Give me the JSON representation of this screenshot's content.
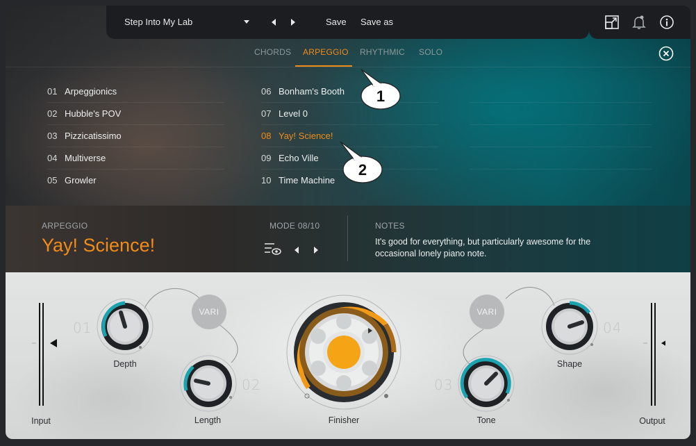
{
  "toolbar": {
    "preset_name": "Step Into My Lab",
    "save_label": "Save",
    "save_as_label": "Save as"
  },
  "tabs": [
    {
      "label": "CHORDS",
      "active": false
    },
    {
      "label": "ARPEGGIO",
      "active": true
    },
    {
      "label": "RHYTHMIC",
      "active": false
    },
    {
      "label": "SOLO",
      "active": false
    }
  ],
  "modes": [
    {
      "num": "01",
      "name": "Arpeggionics"
    },
    {
      "num": "02",
      "name": "Hubble's POV"
    },
    {
      "num": "03",
      "name": "Pizzicatissimo"
    },
    {
      "num": "04",
      "name": "Multiverse"
    },
    {
      "num": "05",
      "name": "Growler"
    },
    {
      "num": "06",
      "name": "Bonham's Booth"
    },
    {
      "num": "07",
      "name": "Level 0"
    },
    {
      "num": "08",
      "name": "Yay! Science!",
      "selected": true
    },
    {
      "num": "09",
      "name": "Echo Ville"
    },
    {
      "num": "10",
      "name": "Time Machine"
    }
  ],
  "callouts": [
    "1",
    "2"
  ],
  "info": {
    "category_label": "ARPEGGIO",
    "title": "Yay! Science!",
    "mode_label": "MODE 08/10",
    "notes_label": "NOTES",
    "notes_text": "It's good for everything, but particularly awesome for the occasional lonely piano note."
  },
  "controls": {
    "input_label": "Input",
    "output_label": "Output",
    "depth": {
      "label": "Depth",
      "num": "01"
    },
    "length": {
      "label": "Length",
      "num": "02"
    },
    "tone": {
      "label": "Tone",
      "num": "03"
    },
    "shape": {
      "label": "Shape",
      "num": "04"
    },
    "finisher": {
      "label": "Finisher"
    },
    "vari_label": "VARI"
  },
  "colors": {
    "accent": "#f08c18",
    "teal": "#1ba3b0"
  },
  "icons": [
    "dropdown-caret-icon",
    "arrow-left-icon",
    "arrow-right-icon",
    "resize-icon",
    "bell-icon",
    "info-icon",
    "close-circle-icon",
    "list-eye-icon"
  ]
}
